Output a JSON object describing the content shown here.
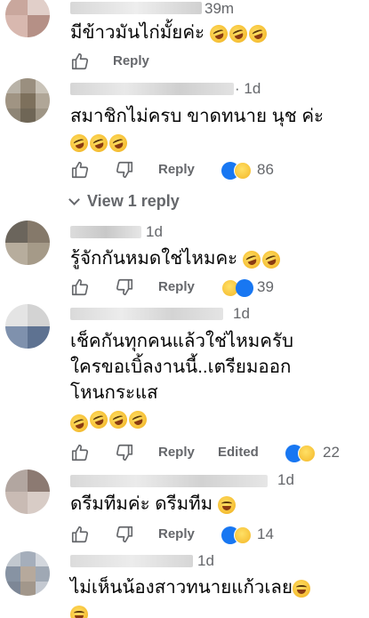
{
  "comments": [
    {
      "time": "39m",
      "text": "มีข้าวมันไก่มั้ยค่ะ",
      "emoji_count": 3,
      "reply_label": "Reply",
      "has_dislike": false,
      "edited_label": "",
      "reaction_count": ""
    },
    {
      "time": "· 1d",
      "text": "สมาชิกไม่ครบ ขาดทนาย นุช ค่ะ",
      "emoji_count": 3,
      "reply_label": "Reply",
      "has_dislike": true,
      "reactions": [
        "like-icon",
        "haha-icon"
      ],
      "reaction_count": "86"
    },
    {
      "time": "1d",
      "text": "รู้จักกันหมดใช่ไหมคะ",
      "emoji_count": 2,
      "reply_label": "Reply",
      "has_dislike": true,
      "reactions": [
        "haha-icon",
        "like-icon"
      ],
      "reaction_count": "39"
    },
    {
      "time": "1d",
      "text_lines": [
        "เช็คกันทุกคนแล้วใช่ไหมครับ",
        "ใครขอเบิ้ลงานนี้..เตรียมออก",
        "โหนกระแส"
      ],
      "emoji_count": 4,
      "reply_label": "Reply",
      "edited_label": "Edited",
      "has_dislike": true,
      "reactions": [
        "like-icon",
        "haha-icon"
      ],
      "reaction_count": "22"
    },
    {
      "time": "1d",
      "text": "ดรีมทีมค่ะ ดรีมทีม",
      "emoji_count": 1,
      "reply_label": "Reply",
      "has_dislike": true,
      "reactions": [
        "like-icon",
        "haha-icon"
      ],
      "reaction_count": "14"
    },
    {
      "time": "1d",
      "text": "ไม่เห็นน้องสาวทนายแก้วเลย",
      "emoji_count": 2
    }
  ],
  "view_replies_label": "View 1 reply",
  "colors": {
    "accent_blue": "#1877f2",
    "meta_gray": "#65676b",
    "text": "#050505"
  }
}
